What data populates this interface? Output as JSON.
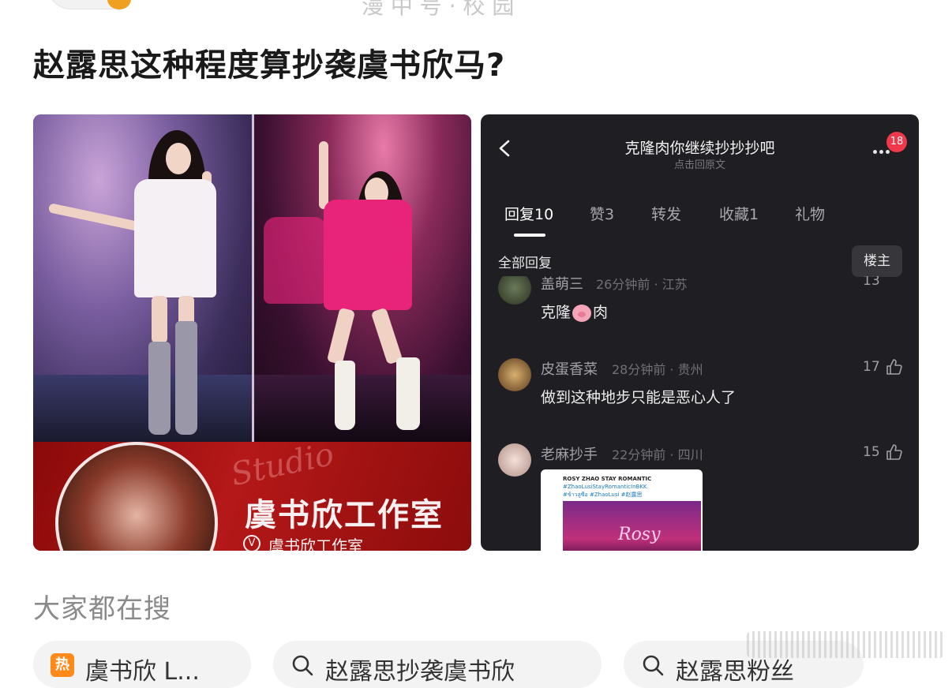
{
  "header": {
    "partial_text": "漫 中 号 · 校 园"
  },
  "post": {
    "title": "赵露思这种程度算抄袭虞书欣马?"
  },
  "left_image": {
    "banner_script": "Studio",
    "banner_name": "虞书欣工作室",
    "banner_verified": "V",
    "banner_sub": "虞书欣工作室"
  },
  "right_image": {
    "title": "克隆肉你继续抄抄抄吧",
    "subtitle": "点击回原文",
    "badge_count": "18",
    "tabs": [
      {
        "label": "回复10"
      },
      {
        "label": "赞3"
      },
      {
        "label": "转发"
      },
      {
        "label": "收藏1"
      },
      {
        "label": "礼物"
      }
    ],
    "all_replies_label": "全部回复",
    "owner_button": "楼主",
    "comments": [
      {
        "name": "盖萌三",
        "meta": "26分钟前 · 江苏",
        "text_before": "克隆",
        "text_after": "肉",
        "likes": "13"
      },
      {
        "name": "皮蛋香菜",
        "meta": "28分钟前 · 贵州",
        "text": "做到这种地步只能是恶心人了",
        "likes": "17"
      },
      {
        "name": "老麻抄手",
        "meta": "22分钟前 · 四川",
        "likes": "15",
        "thumb_line1": "ROSY ZHAO STAY ROMANTIC",
        "thumb_line2": "#ZhaoLusiStayRomanticInBKK",
        "thumb_line3": "#ข้าวลูซือ #ZhaoLusi #赵露思",
        "thumb_text": "Rosy"
      }
    ]
  },
  "search": {
    "heading": "大家都在搜",
    "hot_badge": "热",
    "chips": [
      {
        "label": "虞书欣 L..."
      },
      {
        "label": "赵露思抄袭虞书欣"
      },
      {
        "label": "赵露思粉丝"
      }
    ]
  },
  "colors": {
    "phone_bg": "#1f1f23",
    "badge_red": "#f0384a",
    "banner_red": "#b51818",
    "dress_pink": "#e8247a"
  }
}
